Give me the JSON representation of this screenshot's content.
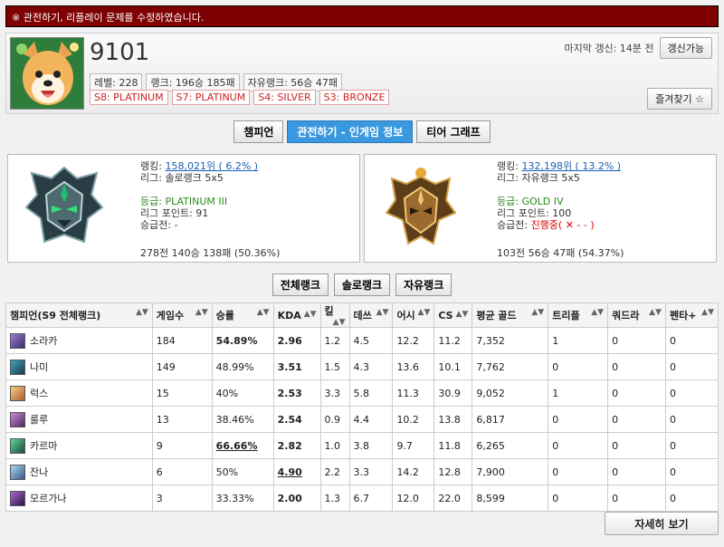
{
  "notice": "※ 관전하기, 리플레이 문제를 수정하였습니다.",
  "profile": {
    "name": "9101",
    "level": "레벨: 228",
    "rank_record": "랭크: 196승 185패",
    "flex_record": "자유랭크: 56승 47패",
    "seasons": [
      "S8: PLATINUM",
      "S7: PLATINUM",
      "S4: SILVER",
      "S3: BRONZE"
    ],
    "last_update": "마지막 갱신: 14분 전",
    "update_button": "갱신가능",
    "favorite_button": "즐겨찾기 ☆"
  },
  "tabs": [
    "챔피언",
    "관전하기 - 인게임 정보",
    "티어 그래프"
  ],
  "solo": {
    "ranking_label": "랭킹: ",
    "ranking_value": "158,021위 ( 6.2% )",
    "league": "리그: 솔로랭크 5x5",
    "tier": "등급: PLATINUM III",
    "lp": "리그 포인트: 91",
    "promo": "승급전: -",
    "summary": "278전 140승 138패 (50.36%)"
  },
  "flex": {
    "ranking_label": "랭킹: ",
    "ranking_value": "132,198위 ( 13.2% )",
    "league": "리그: 자유랭크 5x5",
    "tier": "등급: GOLD IV",
    "lp": "리그 포인트: 100",
    "promo_label": "승급전: ",
    "promo_value": "진행중( ✕ - - )",
    "summary": "103전 56승 47패 (54.37%)"
  },
  "queue_tabs": [
    "전체랭크",
    "솔로랭크",
    "자유랭크"
  ],
  "table": {
    "headers": [
      "챔피언(S9 전체랭크)",
      "게임수",
      "승률",
      "KDA",
      "킬",
      "데쓰",
      "어시",
      "CS",
      "평균 골드",
      "트리플",
      "쿼드라",
      "펜타+"
    ],
    "rows": [
      {
        "champ": "소라카",
        "games": "184",
        "wr": "54.89%",
        "kda": "2.96",
        "k": "1.2",
        "d": "4.5",
        "a": "12.2",
        "cs": "11.2",
        "gold": "7,352",
        "triple": "1",
        "quadra": "0",
        "penta": "0"
      },
      {
        "champ": "나미",
        "games": "149",
        "wr": "48.99%",
        "kda": "3.51",
        "k": "1.5",
        "d": "4.3",
        "a": "13.6",
        "cs": "10.1",
        "gold": "7,762",
        "triple": "0",
        "quadra": "0",
        "penta": "0"
      },
      {
        "champ": "럭스",
        "games": "15",
        "wr": "40%",
        "kda": "2.53",
        "k": "3.3",
        "d": "5.8",
        "a": "11.3",
        "cs": "30.9",
        "gold": "9,052",
        "triple": "1",
        "quadra": "0",
        "penta": "0"
      },
      {
        "champ": "룰루",
        "games": "13",
        "wr": "38.46%",
        "kda": "2.54",
        "k": "0.9",
        "d": "4.4",
        "a": "10.2",
        "cs": "13.8",
        "gold": "6,817",
        "triple": "0",
        "quadra": "0",
        "penta": "0"
      },
      {
        "champ": "카르마",
        "games": "9",
        "wr": "66.66%",
        "kda": "2.82",
        "k": "1.0",
        "d": "3.8",
        "a": "9.7",
        "cs": "11.8",
        "gold": "6,265",
        "triple": "0",
        "quadra": "0",
        "penta": "0"
      },
      {
        "champ": "잔나",
        "games": "6",
        "wr": "50%",
        "kda": "4.90",
        "k": "2.2",
        "d": "3.3",
        "a": "14.2",
        "cs": "12.8",
        "gold": "7,900",
        "triple": "0",
        "quadra": "0",
        "penta": "0"
      },
      {
        "champ": "모르가나",
        "games": "3",
        "wr": "33.33%",
        "kda": "2.00",
        "k": "1.3",
        "d": "6.7",
        "a": "12.0",
        "cs": "22.0",
        "gold": "8,599",
        "triple": "0",
        "quadra": "0",
        "penta": "0"
      }
    ]
  },
  "more_button": "자세히 보기",
  "colors": {
    "notice_bg": "#7f0000",
    "active_tab": "#3a98e0"
  }
}
